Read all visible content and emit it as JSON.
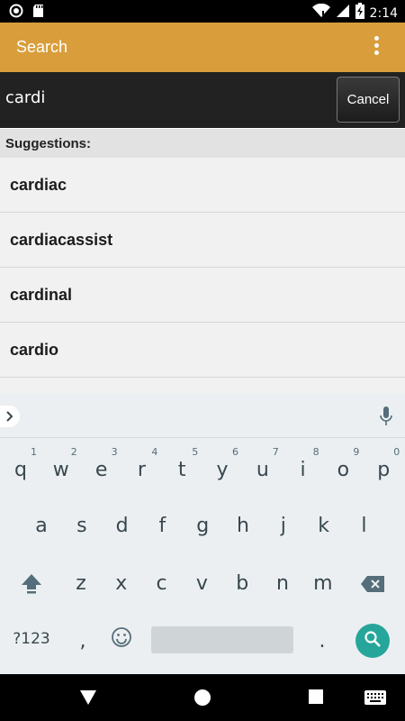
{
  "status_bar": {
    "time": "2:14",
    "icons": [
      "record-icon",
      "sd-card-icon",
      "wifi-icon",
      "signal-icon",
      "battery-charging-icon"
    ]
  },
  "app_bar": {
    "title": "Search",
    "overflow_icon": "more-vert-icon"
  },
  "search": {
    "value": "cardi",
    "cancel_label": "Cancel"
  },
  "suggestions": {
    "header": "Suggestions:",
    "items": [
      "cardiac",
      "cardiacassist",
      "cardinal",
      "cardio"
    ]
  },
  "keyboard": {
    "row1": [
      {
        "k": "q",
        "n": "1"
      },
      {
        "k": "w",
        "n": "2"
      },
      {
        "k": "e",
        "n": "3"
      },
      {
        "k": "r",
        "n": "4"
      },
      {
        "k": "t",
        "n": "5"
      },
      {
        "k": "y",
        "n": "6"
      },
      {
        "k": "u",
        "n": "7"
      },
      {
        "k": "i",
        "n": "8"
      },
      {
        "k": "o",
        "n": "9"
      },
      {
        "k": "p",
        "n": "0"
      }
    ],
    "row2": [
      "a",
      "s",
      "d",
      "f",
      "g",
      "h",
      "j",
      "k",
      "l"
    ],
    "row3": [
      "z",
      "x",
      "c",
      "v",
      "b",
      "n",
      "m"
    ],
    "symbols_label": "?123",
    "comma": ",",
    "period": ".",
    "accent_color": "#26a69a"
  },
  "colors": {
    "app_bar": "#d99e3b",
    "search_bar": "#222222"
  }
}
